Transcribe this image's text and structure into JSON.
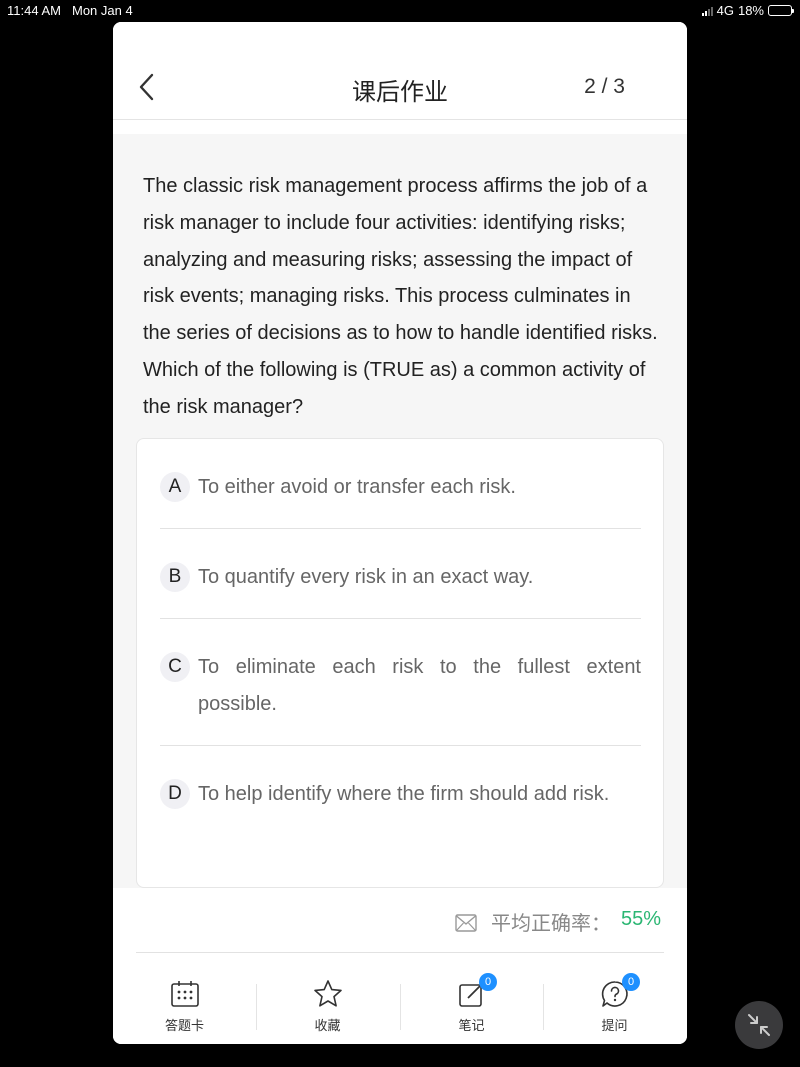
{
  "status_bar": {
    "time": "11:44 AM",
    "date": "Mon Jan 4",
    "network": "4G",
    "battery": "18%"
  },
  "nav": {
    "title": "课后作业",
    "counter": "2 / 3",
    "back_icon": "chevron-left-icon"
  },
  "question": {
    "text": "The classic risk management process affirms the job of a risk manager to include four activities: identifying risks; analyzing and measuring risks; assessing the impact of risk events; managing risks. This process culminates in the series of decisions as to how to handle identified risks. Which of the following is (TRUE as) a common activity of the risk manager?"
  },
  "options": [
    {
      "letter": "A",
      "text": "To either avoid or transfer each risk."
    },
    {
      "letter": "B",
      "text": "To quantify every risk in an exact way."
    },
    {
      "letter": "C",
      "text": "To eliminate each risk to the fullest extent possible."
    },
    {
      "letter": "D",
      "text": "To help identify where the firm should add risk."
    }
  ],
  "stats": {
    "label": "平均正确率：",
    "value": "55%",
    "value_color": "#2bb673",
    "icon": "envelope-icon"
  },
  "tabbar": {
    "answer_card": {
      "label": "答题卡",
      "icon": "answer-card-icon"
    },
    "favorite": {
      "label": "收藏",
      "icon": "star-icon"
    },
    "notes": {
      "label": "笔记",
      "badge": "0",
      "icon": "edit-note-icon"
    },
    "ask": {
      "label": "提问",
      "badge": "0",
      "icon": "question-bubble-icon"
    }
  },
  "colors": {
    "accent_badge": "#1e90ff",
    "background": "#000000"
  }
}
